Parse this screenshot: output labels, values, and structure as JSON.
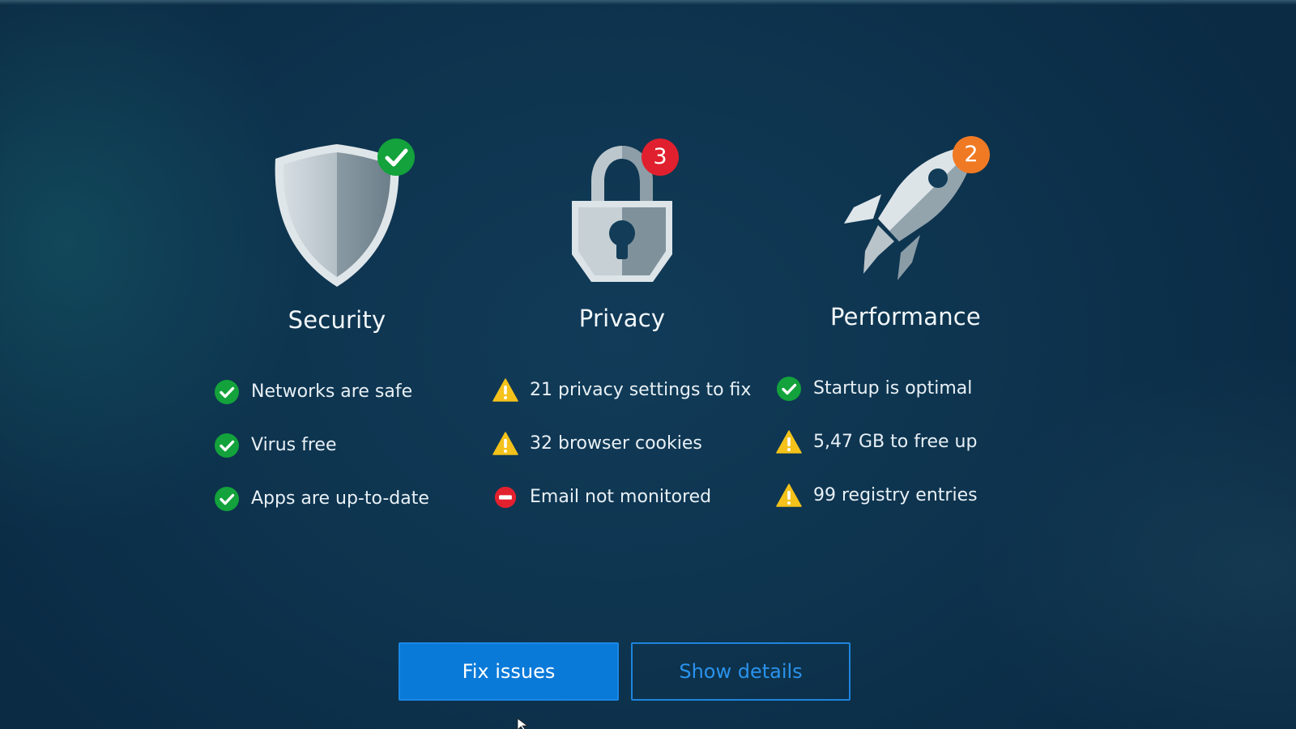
{
  "categories": [
    {
      "id": "security",
      "title": "Security",
      "icon": "shield-icon",
      "badge_type": "check",
      "items": [
        {
          "status": "ok",
          "text": "Networks are safe"
        },
        {
          "status": "ok",
          "text": "Virus free"
        },
        {
          "status": "ok",
          "text": "Apps are up-to-date"
        }
      ]
    },
    {
      "id": "privacy",
      "title": "Privacy",
      "icon": "padlock-icon",
      "badge": "3",
      "badge_color": "#e0202e",
      "items": [
        {
          "status": "warning",
          "text": "21 privacy settings to fix"
        },
        {
          "status": "warning",
          "text": "32 browser cookies"
        },
        {
          "status": "error",
          "text": "Email not monitored"
        }
      ]
    },
    {
      "id": "performance",
      "title": "Performance",
      "icon": "rocket-icon",
      "badge": "2",
      "badge_color": "#f07a24",
      "items": [
        {
          "status": "ok",
          "text": "Startup is optimal"
        },
        {
          "status": "warning",
          "text": "5,47 GB to free up"
        },
        {
          "status": "warning",
          "text": "99 registry entries"
        }
      ]
    }
  ],
  "actions": {
    "fix_label": "Fix issues",
    "details_label": "Show details"
  },
  "colors": {
    "ok": "#13a23b",
    "warning": "#f4c21b",
    "error": "#e3202e",
    "primary_button": "#0a7ad9",
    "background": "#0e3550"
  }
}
